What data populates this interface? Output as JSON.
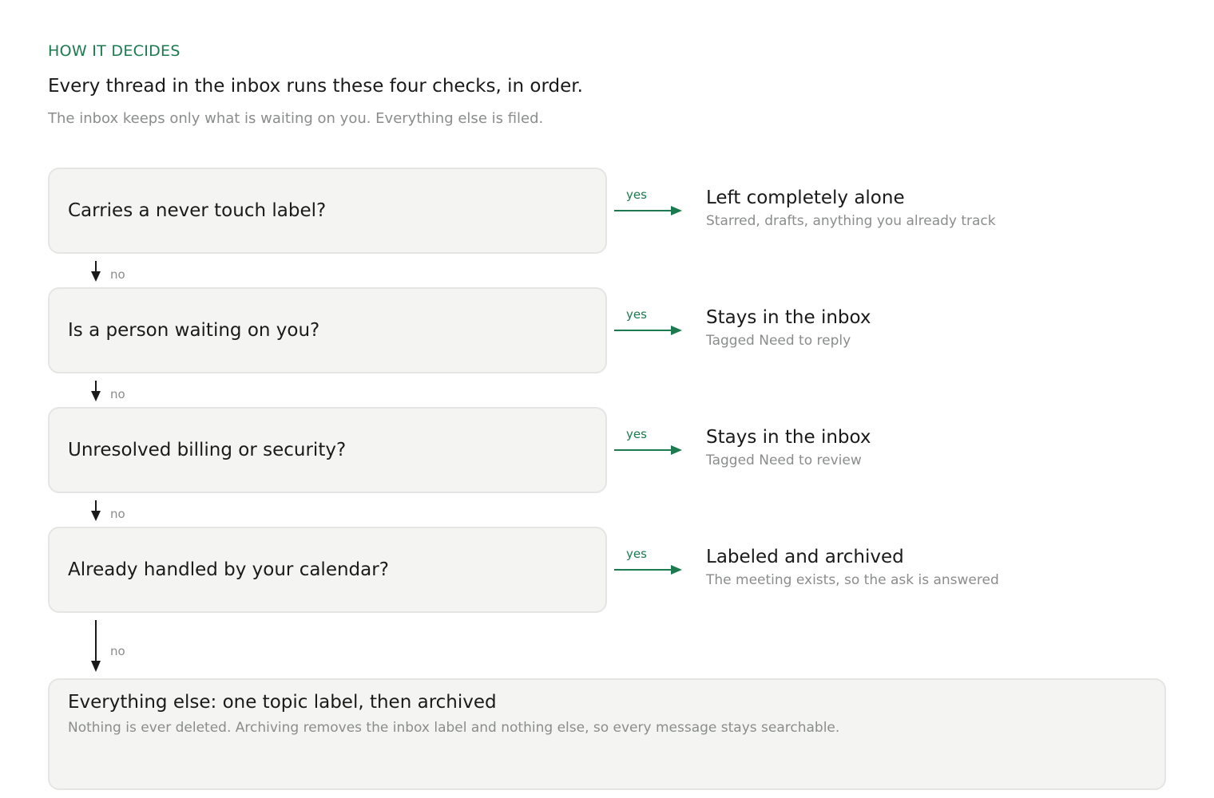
{
  "header": {
    "eyebrow": "HOW IT DECIDES",
    "headline": "Every thread in the inbox runs these four checks, in order.",
    "subline": "The inbox keeps only what is waiting on you. Everything else is filed."
  },
  "branch_labels": {
    "yes": "yes",
    "no": "no"
  },
  "checks": [
    {
      "question": "Carries a never touch label?",
      "outcome_title": "Left completely alone",
      "outcome_detail": "Starred, drafts, anything you already track"
    },
    {
      "question": "Is a person waiting on you?",
      "outcome_title": "Stays in the inbox",
      "outcome_detail": "Tagged Need to reply"
    },
    {
      "question": "Unresolved billing or security?",
      "outcome_title": "Stays in the inbox",
      "outcome_detail": "Tagged Need to review"
    },
    {
      "question": "Already handled by your calendar?",
      "outcome_title": "Labeled and archived",
      "outcome_detail": "The meeting exists, so the ask is answered"
    }
  ],
  "fallback": {
    "title": "Everything else: one topic label, then archived",
    "detail": "Nothing is ever deleted. Archiving removes the inbox label and nothing else, so every message stays searchable."
  },
  "colors": {
    "accent": "#1b7a4e",
    "text": "#1a1a1a",
    "muted": "#8a8d8b",
    "box_fill": "#f4f5f3",
    "box_border": "#e3e6e3"
  }
}
